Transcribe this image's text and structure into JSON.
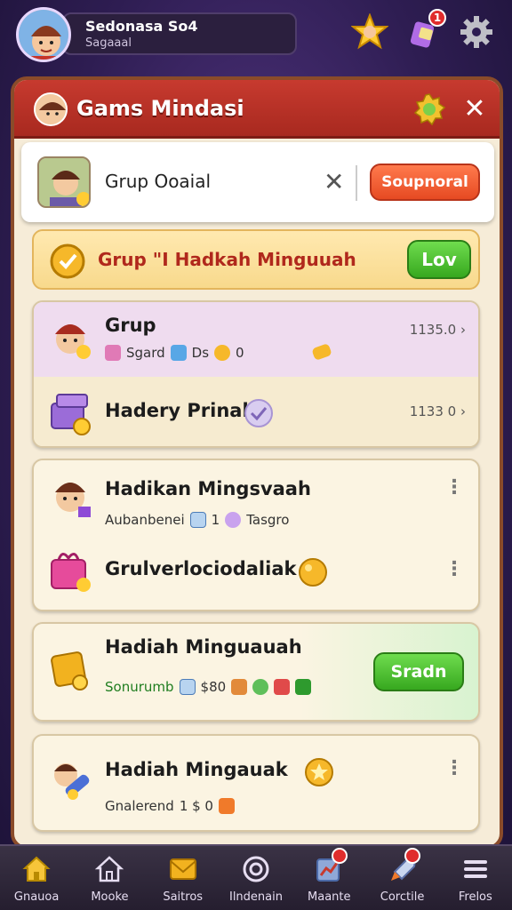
{
  "player": {
    "name": "Sedonasa So4",
    "subtitle": "Sagaaal"
  },
  "top_icons": {
    "notif_count": "1"
  },
  "panel": {
    "title": "Gams Mindasi",
    "search_title": "Grup Ooaial",
    "search_button": "Soupnoral"
  },
  "banner": {
    "title": "Grup \"I Hadkah Minguuah",
    "button": "Lov"
  },
  "cards": [
    {
      "rows": [
        {
          "title": "Grup",
          "sub_text": "Sgard",
          "sub_extra": "Ds",
          "sub_num": "0",
          "value": "1135.0"
        },
        {
          "title": "Hadery Prinal",
          "value": "1133 0"
        }
      ]
    },
    {
      "rows": [
        {
          "title": "Hadikan Mingsvaah",
          "sub_text": "Aubanbenei",
          "sub_num": "1",
          "sub_extra": "Tasgro"
        },
        {
          "title": "Grulverlociodaliak"
        }
      ]
    },
    {
      "rows": [
        {
          "title": "Hadiah Minguauah",
          "sub_text": "Sonurumb",
          "sub_num": "$80",
          "button": "Sradn"
        }
      ]
    },
    {
      "rows": [
        {
          "title": "Hadiah Mingauak",
          "sub_text": "Gnalerend",
          "sub_num": "1 $ 0"
        }
      ]
    }
  ],
  "nav": [
    {
      "label": "Gnauoa",
      "icon": "home-icon"
    },
    {
      "label": "Mooke",
      "icon": "house-outline-icon"
    },
    {
      "label": "Saitros",
      "icon": "envelope-icon"
    },
    {
      "label": "Ilndenain",
      "icon": "circle-target-icon"
    },
    {
      "label": "Maante",
      "icon": "chart-icon"
    },
    {
      "label": "Corctile",
      "icon": "rocket-icon"
    },
    {
      "label": "Frelos",
      "icon": "menu-icon"
    }
  ]
}
